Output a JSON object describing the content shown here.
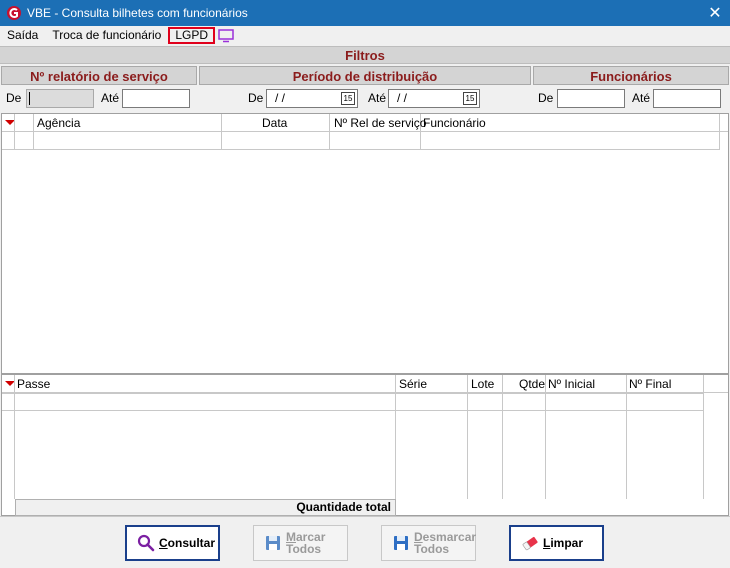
{
  "window": {
    "title": "VBE - Consulta bilhetes com funcionários",
    "close_glyph": "✕"
  },
  "menu": {
    "items": [
      {
        "label": "Saída"
      },
      {
        "label": "Troca de funcionário"
      },
      {
        "label": "LGPD",
        "highlighted": true
      }
    ],
    "icon": "monitor-icon"
  },
  "filters": {
    "header": "Filtros",
    "relatorio": {
      "title": "Nº relatório de serviço",
      "de_label": "De",
      "ate_label": "Até",
      "de_value": "",
      "ate_value": ""
    },
    "periodo": {
      "title": "Período de distribuição",
      "de_label": "De",
      "ate_label": "Até",
      "de_value": " / /",
      "ate_value": " / /",
      "calendar_icon_text": "15"
    },
    "funcionarios": {
      "title": "Funcionários",
      "de_label": "De",
      "ate_label": "Até",
      "de_value": "",
      "ate_value": ""
    }
  },
  "grid_top": {
    "columns": [
      "Agência",
      "Data",
      "Nº Rel de serviço",
      "Funcionário"
    ],
    "rows": []
  },
  "grid_bottom": {
    "columns": [
      "Passe",
      "Série",
      "Lote",
      "Qtde",
      "Nº Inicial",
      "Nº Final"
    ],
    "rows": [],
    "total_label": "Quantidade total"
  },
  "buttons": {
    "consultar": {
      "label_first": "C",
      "label_rest": "onsultar",
      "enabled": true
    },
    "marcar": {
      "line1_first": "M",
      "line1_rest": "arcar",
      "line2": "Todos",
      "enabled": false
    },
    "desmarcar": {
      "line1_first": "D",
      "line1_rest": "esmarcar",
      "line2": "Todos",
      "enabled": false
    },
    "limpar": {
      "label_first": "L",
      "label_rest": "impar",
      "enabled": true
    }
  },
  "colors": {
    "titlebar": "#1c6fb5",
    "section_title": "#8b1c1c",
    "highlight_border": "#e0001b",
    "sort_arrow": "#d00000"
  }
}
